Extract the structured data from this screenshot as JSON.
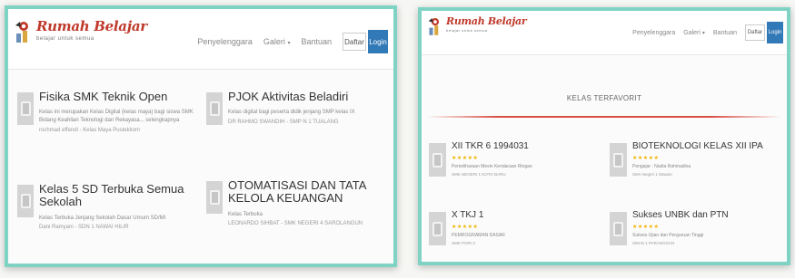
{
  "brand": {
    "name": "Rumah Belajar",
    "tagline": "belajar untuk semua"
  },
  "nav": {
    "penyelenggara": "Penyelenggara",
    "galeri": "Galeri",
    "bantuan": "Bantuan",
    "daftar": "Daftar",
    "login": "Login"
  },
  "left_page": {
    "cards": [
      {
        "title": "Fisika SMK Teknik Open",
        "desc": "Kelas ini merupakan Kelas Digital (kelas maya) bagi siswa SMK Bidang Keahlian Teknologi dan Rekayasa... selengkapnya",
        "meta": "rochmad effendi - Kelas Maya Pustekkom"
      },
      {
        "title": "PJOK Aktivitas Beladiri",
        "desc": "Kelas digital bagi peserta didik jenjang SMP kelas IX",
        "meta": "DR RAHMO SWANDIH - SMP N 1 TUALANG"
      },
      {
        "title": "Kelas 5 SD Terbuka Semua Sekolah",
        "desc": "Kelas Terbuka Jenjang Sekolah Dasar Umum SD/MI",
        "meta": "Dani Ramyani - SDN 1 NAWAI HILIR"
      },
      {
        "title": "OTOMATISASI DAN TATA KELOLA KEUANGAN",
        "desc": "Kelas Terbuka",
        "meta": "LEONARDO SIHBAT - SMK NEGERI 4 SAROLANGUN"
      }
    ]
  },
  "right_page": {
    "section_title": "KELAS TERFAVORIT",
    "stars": "★★★★★",
    "cards": [
      {
        "title": "XII TKR 6 1994031",
        "desc": "Pemeliharaan Mesin Kendaraan Ringan",
        "meta": "SMK NEGERI 1 KOTO BARU"
      },
      {
        "title": "BIOTEKNOLOGI KELAS XII IPA",
        "desc": "Pengajar : Nadia Rahmadina",
        "meta": "SMA Negeri 1 Wawan"
      },
      {
        "title": "X TKJ 1",
        "desc": "PEMROGRAMAN DASAR",
        "meta": "SMK PGRI 3"
      },
      {
        "title": "Sukses UNBK dan PTN",
        "desc": "Sukses Ujian dan Perguruan Tinggi",
        "meta": "SMAN 1 PARANGGAN"
      }
    ]
  },
  "colors": {
    "frame_border": "#7fd3c4",
    "login_button": "#3279b7",
    "brand_red": "#c0392b",
    "divider": "#d94e43",
    "stars": "#f0b400"
  }
}
